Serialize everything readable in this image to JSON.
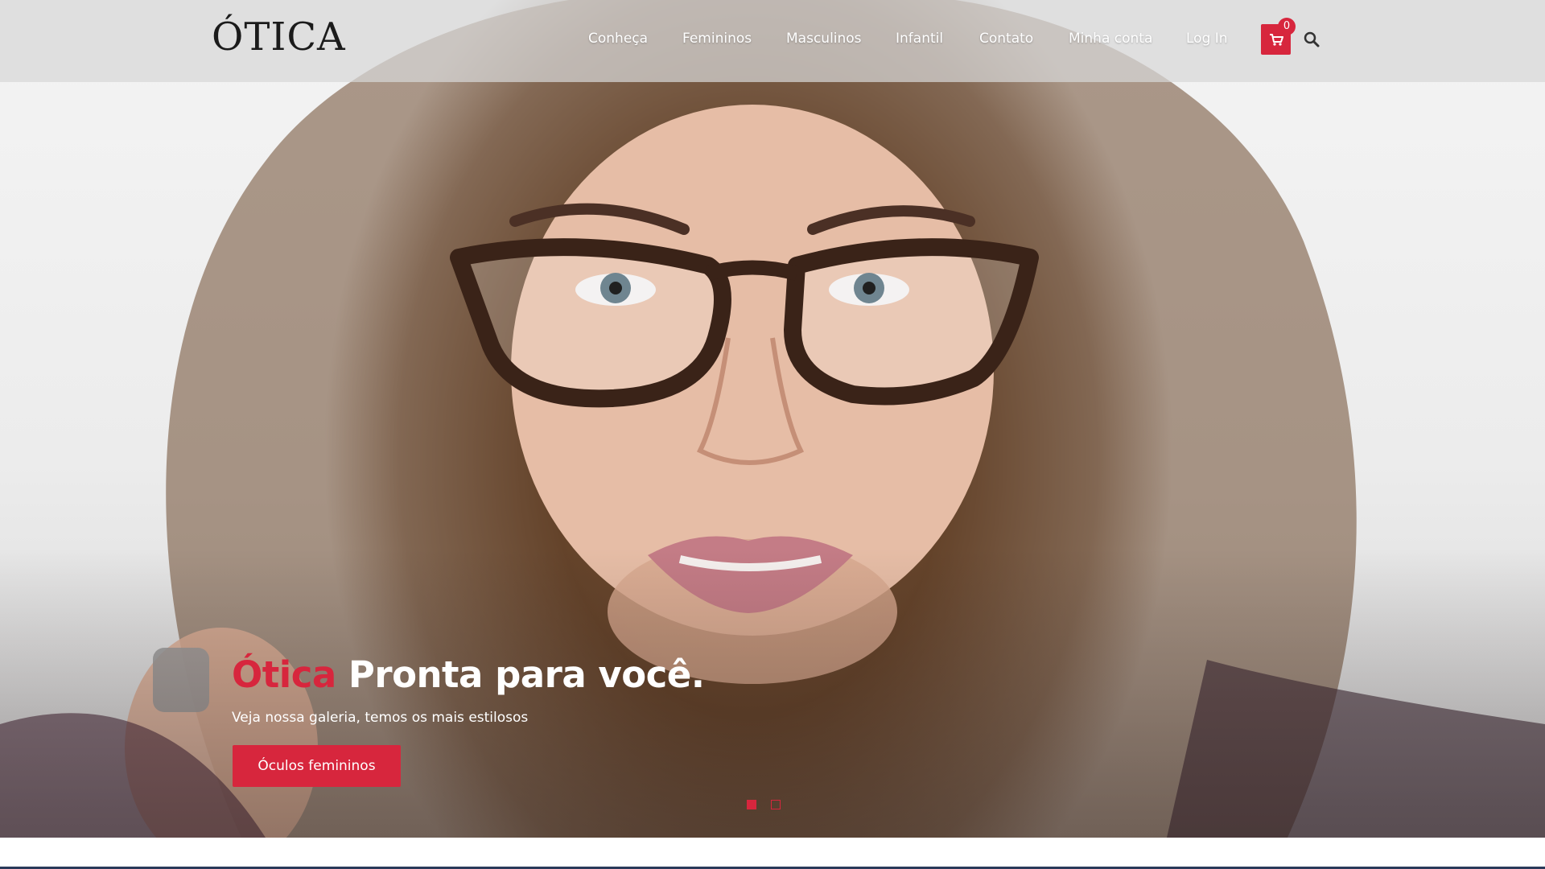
{
  "header": {
    "logo": "ÓTICA",
    "nav": [
      {
        "label": "Conheça"
      },
      {
        "label": "Femininos"
      },
      {
        "label": "Masculinos"
      },
      {
        "label": "Infantil"
      },
      {
        "label": "Contato"
      },
      {
        "label": "Minha conta"
      },
      {
        "label": "Log In"
      }
    ],
    "cart_count": "0",
    "icons": {
      "cart": "cart-icon",
      "search": "search-icon"
    }
  },
  "hero": {
    "headline_brand": "Ótica",
    "headline_rest": "Pronta para você.",
    "subtitle": "Veja nossa galeria, temos os mais estilosos",
    "cta_label": "Óculos femininos",
    "slides": 2,
    "active_slide": 1
  },
  "colors": {
    "accent": "#d7263d",
    "header_bg": "#d7d7d7",
    "text_light": "#ffffff",
    "logo": "#1b1b1b"
  }
}
